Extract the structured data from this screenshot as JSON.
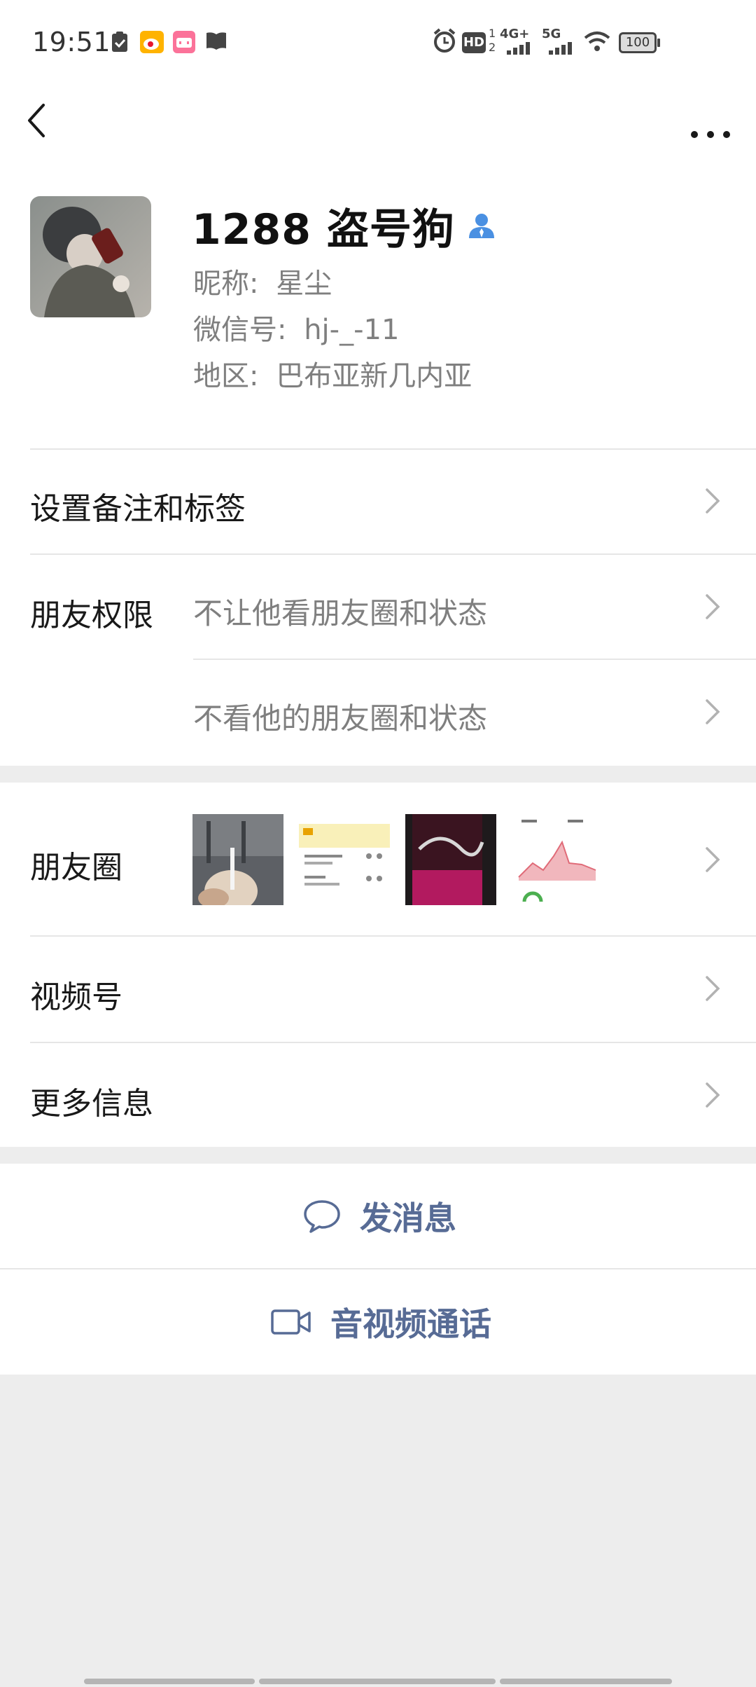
{
  "status_bar": {
    "time": "19:51",
    "left_icons": [
      "shield-check-icon",
      "weibo-icon",
      "bilibili-icon",
      "book-icon"
    ],
    "right_icons": [
      "alarm-icon",
      "hd-icon",
      "signal-4g-icon",
      "signal-5g-icon",
      "wifi-icon"
    ],
    "hd_label": "HD",
    "net1": "4G+",
    "net2": "5G",
    "battery": "100"
  },
  "nav": {
    "back_icon": "back-arrow-icon",
    "more_icon": "more-dots-icon"
  },
  "profile": {
    "name": "1288 盗号狗",
    "nickname_label": "昵称:",
    "nickname": "星尘",
    "wechat_id_label": "微信号:",
    "wechat_id": "hj-_-11",
    "region_label": "地区:",
    "region": "巴布亚新几内亚"
  },
  "rows": {
    "remark": "设置备注和标签",
    "permissions_label": "朋友权限",
    "perm_1": "不让他看朋友圈和状态",
    "perm_2": "不看他的朋友圈和状态",
    "moments": "朋友圈",
    "channels": "视频号",
    "more_info": "更多信息"
  },
  "moments_thumbs": [
    {
      "name": "moment-thumb-drink",
      "colors": [
        "#6e6e6e",
        "#c9b8a6"
      ]
    },
    {
      "name": "moment-thumb-screenshot",
      "colors": [
        "#f7f1c8",
        "#ffffff"
      ]
    },
    {
      "name": "moment-thumb-cola",
      "colors": [
        "#2a1a1c",
        "#b0185a"
      ]
    },
    {
      "name": "moment-thumb-chart",
      "colors": [
        "#ffffff",
        "#e9a3aa"
      ]
    }
  ],
  "actions": {
    "message": "发消息",
    "call": "音视频通话"
  },
  "colors": {
    "link": "#576b95",
    "verify_blue": "#4a90e2"
  }
}
